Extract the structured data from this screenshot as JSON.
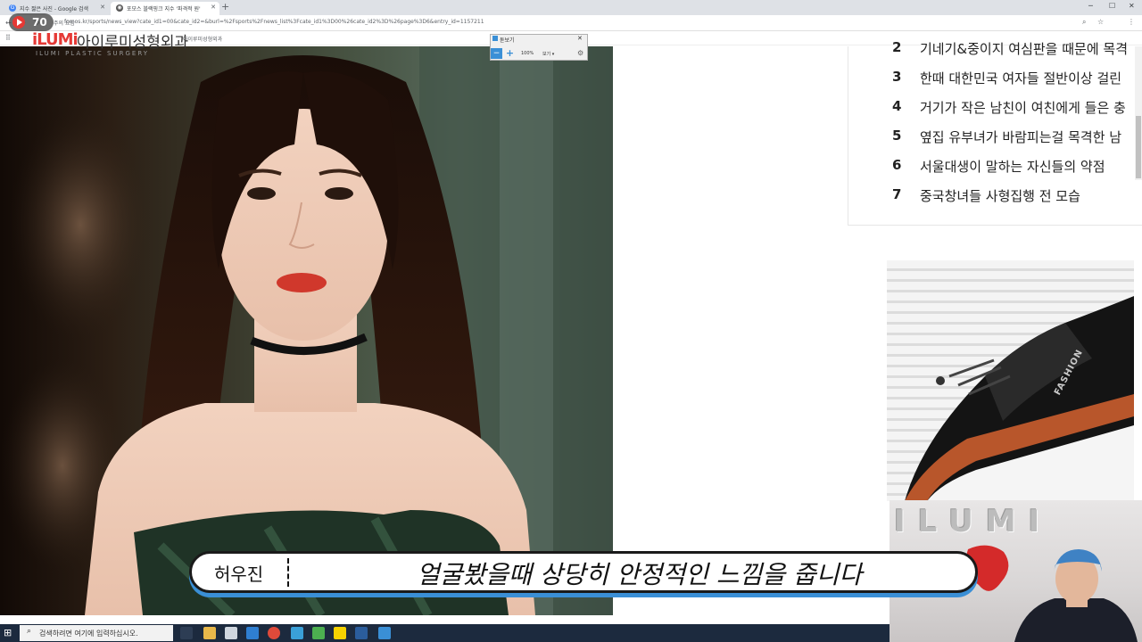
{
  "browser": {
    "tabs": [
      {
        "title": "지수 짧은 사진 - Google 검색",
        "active": false
      },
      {
        "title": "포모스 블랙핑크 지수 '파격적 원'",
        "active": true
      }
    ],
    "address": "fomos.kr/sports/news_view?cate_id1=00&cate_id2=&burl=%2Fsports%2Fnews_list%3Fcate_id1%3D00%26cate_id2%3D%26page%3D6&entry_id=1157211",
    "security_label": "주의 요함",
    "bookmark": "아이루미성형외과"
  },
  "overlay": {
    "view_count": "70",
    "logo": "iLUMi",
    "clinic_name_ko": "아이루미성형외과",
    "clinic_name_en": "ILUMI PLASTIC SURGERY"
  },
  "snip_tool": {
    "title": "돋보기",
    "zoom": "100%",
    "view_menu": "보기 ▾"
  },
  "rank_list": [
    {
      "rank": "2",
      "title": "기네기&중이지 여심판을 때문에 목격"
    },
    {
      "rank": "3",
      "title": "한때 대한민국 여자들 절반이상 걸린"
    },
    {
      "rank": "4",
      "title": "거기가 작은 남친이 여친에게 들은 충"
    },
    {
      "rank": "5",
      "title": "옆집 유부녀가 바람피는걸 목격한 남"
    },
    {
      "rank": "6",
      "title": "서울대생이 말하는 자신들의 약점"
    },
    {
      "rank": "7",
      "title": "중국창녀들 사형집행 전 모습"
    }
  ],
  "ad": {
    "brand": "FASHION"
  },
  "webcam": {
    "balloon_letters": "ILUMI"
  },
  "subtitle": {
    "speaker": "허우진",
    "text": "얼굴봤을때 상당히 안정적인 느낌을 줍니다"
  },
  "taskbar": {
    "search_placeholder": "검색하려면 여기에 입력하십시오."
  }
}
